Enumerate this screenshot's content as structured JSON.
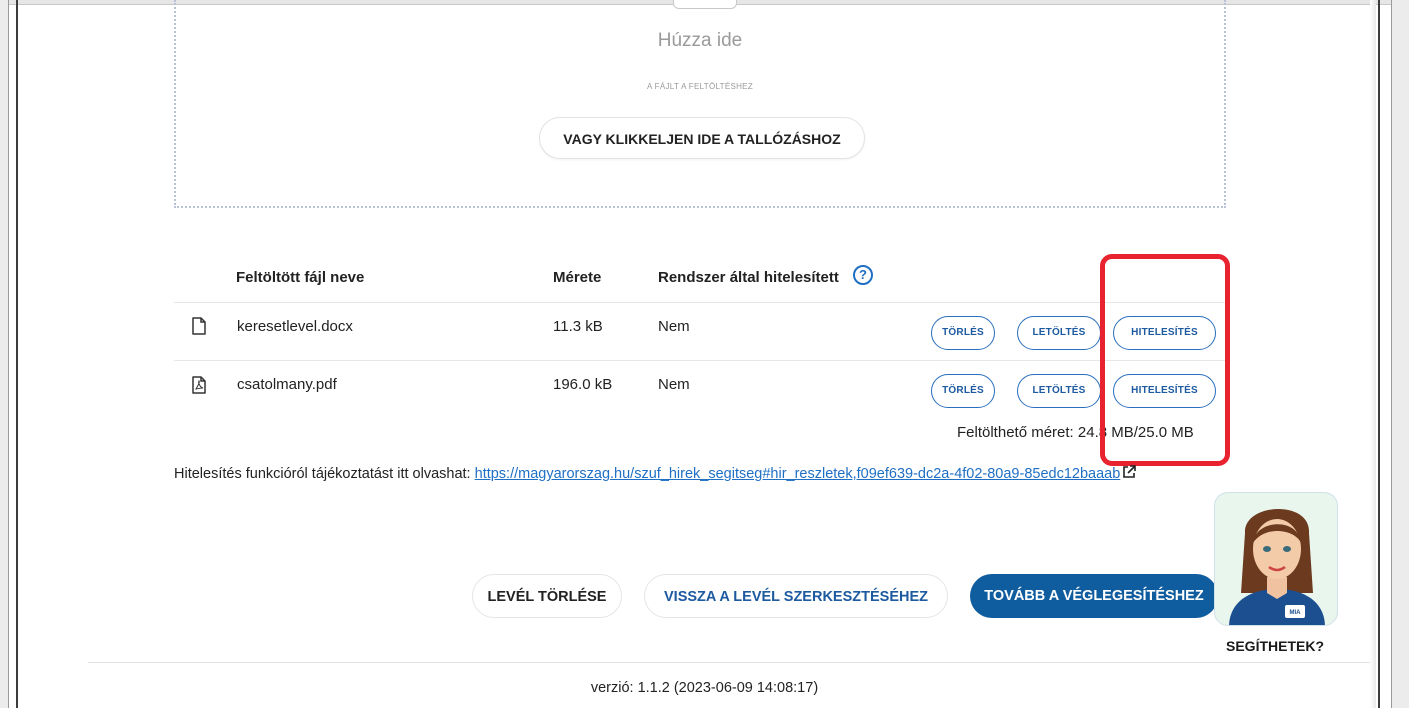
{
  "dropzone": {
    "title": "Húzza ide",
    "subtitle": "A FÁJLT A FELTÖLTÉSHEZ",
    "browse_label": "VAGY KLIKKELJEN IDE A TALLÓZÁSHOZ"
  },
  "table": {
    "headers": {
      "name": "Feltöltött fájl neve",
      "size": "Mérete",
      "certified": "Rendszer által hitelesített"
    },
    "rows": [
      {
        "icon": "document-icon",
        "name": "keresetlevel.docx",
        "size": "11.3 kB",
        "certified": "Nem",
        "delete": "TÖRLÉS",
        "download": "LETÖLTÉS",
        "authenticate": "HITELESÍTÉS"
      },
      {
        "icon": "pdf-icon",
        "name": "csatolmany.pdf",
        "size": "196.0 kB",
        "certified": "Nem",
        "delete": "TÖRLÉS",
        "download": "LETÖLTÉS",
        "authenticate": "HITELESÍTÉS"
      }
    ],
    "help_icon_glyph": "?"
  },
  "quota": "Feltölthető méret: 24.8 MB/25.0 MB",
  "info": {
    "text": "Hitelesítés funkcióról tájékoztatást itt olvashat: ",
    "link": "https://magyarorszag.hu/szuf_hirek_segitseg#hir_reszletek,f09ef639-dc2a-4f02-80a9-85edc12baaab"
  },
  "actions": {
    "delete_letter": "LEVÉL TÖRLÉSE",
    "back_to_edit": "VISSZA A LEVÉL SZERKESZTÉSÉHEZ",
    "continue": "TOVÁBB A VÉGLEGESÍTÉSHEZ"
  },
  "assistant": {
    "label": "SEGÍTHETEK?",
    "badge": "MIA"
  },
  "footer": {
    "version": "verzió: 1.1.2 (2023-06-09 14:08:17)"
  },
  "colors": {
    "accent": "#1f6fc4",
    "primary_button": "#0f5c9f",
    "highlight": "#e8232f"
  }
}
